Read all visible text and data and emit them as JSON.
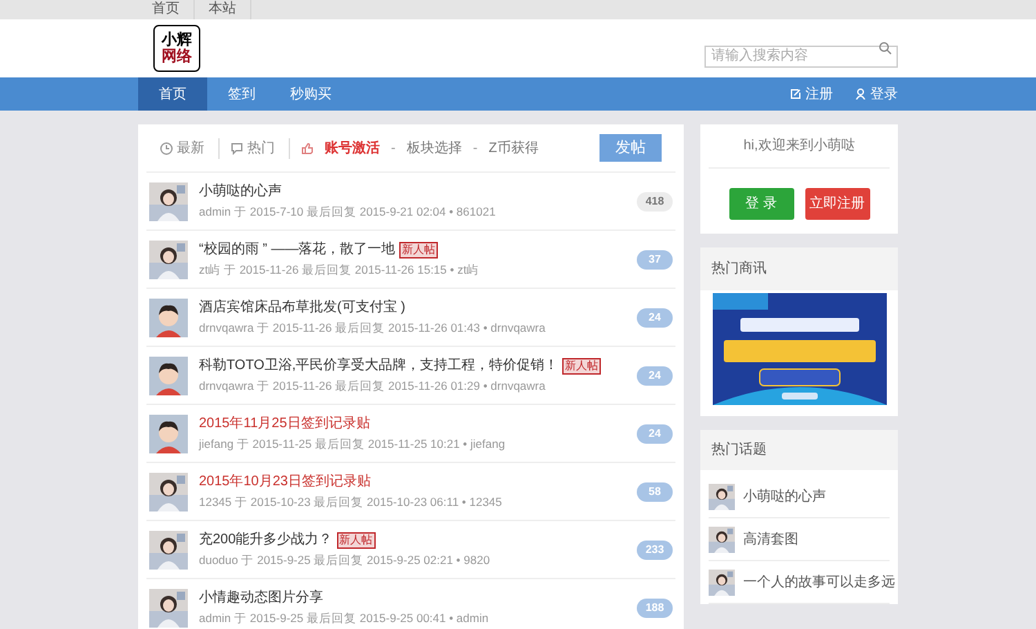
{
  "top_links": [
    "首页",
    "本站"
  ],
  "logo": {
    "line_1": "小辉",
    "line_2": "网络"
  },
  "search": {
    "placeholder": "请输入搜索内容"
  },
  "nav": {
    "items": [
      {
        "label": "首页",
        "selected": true
      },
      {
        "label": "签到",
        "selected": false
      },
      {
        "label": "秒购买",
        "selected": false
      }
    ],
    "register": "注册",
    "login": "登录"
  },
  "filters": {
    "tabs": [
      {
        "label": "最新",
        "selected": false
      },
      {
        "label": "热门",
        "selected": false
      }
    ],
    "links": [
      {
        "label": "账号激活",
        "hot": true
      },
      {
        "separator": "-",
        "label": "板块选择",
        "hot": false
      },
      {
        "separator": "-",
        "label": "Z币获得",
        "hot": false
      }
    ],
    "post_button": "发帖"
  },
  "threads": [
    {
      "title": "小萌哒的心声",
      "kind": "normal",
      "meta": "admin 于 2015-7-10 最后回复 2015-9-21 02:04 • 861021",
      "count": "418",
      "unread": false
    },
    {
      "title": "“校园的雨 ” ——落花，散了一地",
      "kind": "normal",
      "badge": "新人帖",
      "meta": "zt屿 于 2015-11-26 最后回复 2015-11-26 15:15 • zt屿",
      "count": "37",
      "unread": true
    },
    {
      "title": "酒店宾馆床品布草批发(可支付宝 )",
      "kind": "normal",
      "meta": "drnvqawra 于 2015-11-26 最后回复 2015-11-26 01:43 • drnvqawra",
      "count": "24",
      "unread": true
    },
    {
      "title": "科勒TOTO卫浴,平民价享受大品牌，支持工程，特价促销！",
      "kind": "normal",
      "badge": "新人帖",
      "meta": "drnvqawra 于 2015-11-26 最后回复 2015-11-26 01:29 • drnvqawra",
      "count": "24",
      "unread": true
    },
    {
      "title": "2015年11月25日签到记录贴",
      "kind": "checkin",
      "meta": "jiefang 于 2015-11-25 最后回复 2015-11-25 10:21 • jiefang",
      "count": "24",
      "unread": true
    },
    {
      "title": "2015年10月23日签到记录贴",
      "kind": "checkin",
      "meta": "12345 于 2015-10-23 最后回复 2015-10-23 06:11 • 12345",
      "count": "58",
      "unread": true
    },
    {
      "title": "充200能升多少战力？",
      "kind": "normal",
      "badge": "新人帖",
      "meta": "duoduo 于 2015-9-25 最后回复 2015-9-25 02:21 • 9820",
      "count": "233",
      "unread": true
    },
    {
      "title": "小情趣动态图片分享",
      "kind": "normal",
      "meta": "admin 于 2015-9-25 最后回复 2015-9-25 00:41 • admin",
      "count": "188",
      "unread": true
    }
  ],
  "welcome": {
    "text": "hi,欢迎来到小萌哒",
    "login_button": "登 录",
    "register_button": "立即注册"
  },
  "hot_news": {
    "title": "热门商讯"
  },
  "hot_topics": {
    "title": "热门话题",
    "items": [
      "小萌哒的心声",
      "高清套图",
      "一个人的故事可以走多远"
    ]
  }
}
